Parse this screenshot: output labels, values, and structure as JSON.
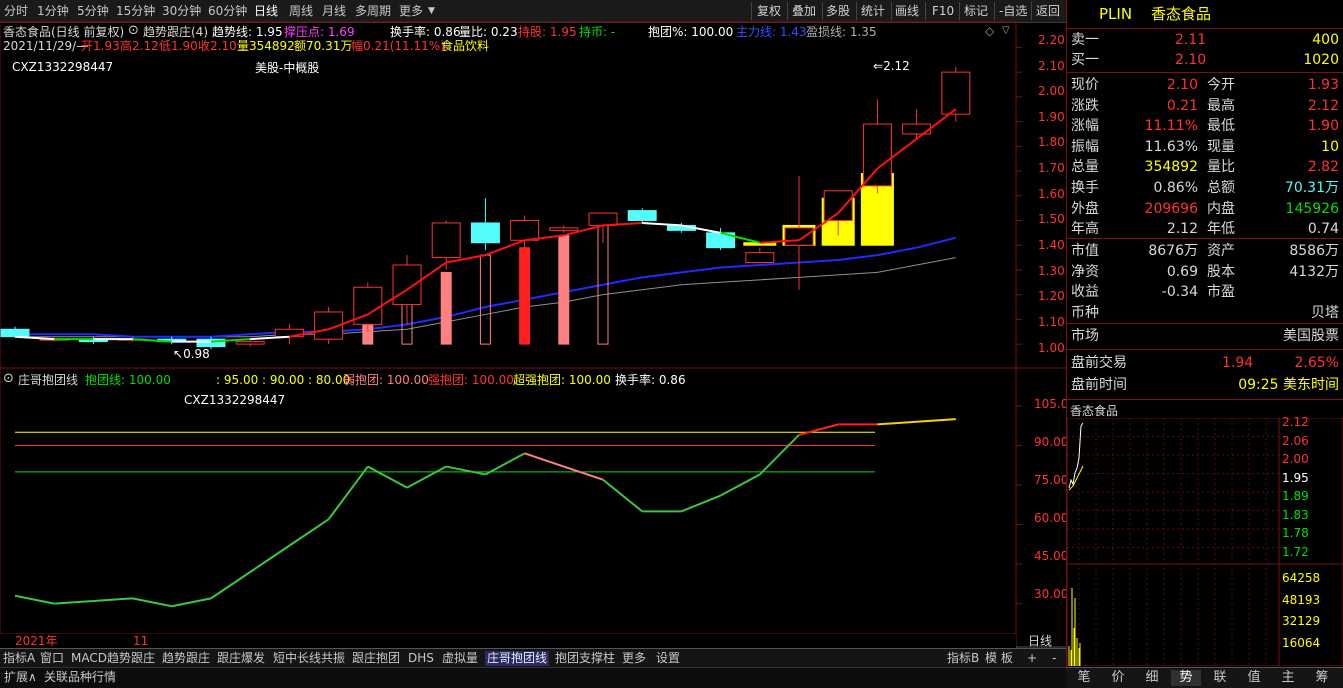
{
  "topbar": {
    "periods": [
      "分时",
      "1分钟",
      "5分钟",
      "15分钟",
      "30分钟",
      "60分钟",
      "日线",
      "周线",
      "月线",
      "多周期",
      "更多"
    ],
    "selected_period": "日线",
    "tools": [
      "复权",
      "叠加",
      "多股",
      "统计",
      "画线",
      "F10",
      "标记",
      "-自选",
      "返回"
    ]
  },
  "info": {
    "stock_title": "香态食品(日线 前复权)",
    "indicator_name": "趋势跟庄(4)",
    "trend_label": "趋势线: 1.95",
    "press_label": "撑压点: 1.69",
    "turnover_label": "换手率: 0.86",
    "volratio_label": "量比: 0.23",
    "hold_label": "持股: 1.95",
    "holdcash_label": "持币: -",
    "baotuan_label": "抱团%: 100.00",
    "main_label": "主力线: 1.43",
    "pnl_label": "盈损线: 1.35",
    "date": "2021/11/29/—",
    "open": "开1.93",
    "high": "高2.12",
    "low": "低1.90",
    "close": "收2.10",
    "vol": "量354892",
    "amount": "额70.31万",
    "change": "幅0.21(11.11%)",
    "sector": "食品饮料",
    "code_label": "CXZ1332298447",
    "market_label": "美股-中概股",
    "high_mark": "2.12",
    "low_mark": "0.98"
  },
  "price_axis": [
    "2.20",
    "2.10",
    "2.00",
    "1.90",
    "1.80",
    "1.70",
    "1.60",
    "1.50",
    "1.40",
    "1.30",
    "1.20",
    "1.10",
    "1.00"
  ],
  "lower": {
    "title": "庄哥抱团线",
    "line_label": "抱团线: 100.00",
    "levels_label": ": 95.00 : 90.00 : 80.00",
    "weak_label": "弱抱团: 100.00",
    "strong_label": "强抱团: 100.00",
    "super_label": "超强抱团: 100.00",
    "turnover_label": "换手率: 0.86",
    "code_label": "CXZ1332298447",
    "axis": [
      "105.0",
      "90.00",
      "75.00",
      "60.00",
      "45.00",
      "30.00"
    ]
  },
  "time_axis": {
    "year": "2021年",
    "month": "11",
    "period": "日线"
  },
  "bottom_tabs": [
    "指标A",
    "窗口",
    "MACD趋势跟庄",
    "趋势跟庄",
    "跟庄爆发",
    "短中长线共振",
    "跟庄抱团",
    "DHS",
    "虚拟量",
    "庄哥抱团线",
    "抱团支撑柱",
    "更多",
    "设置"
  ],
  "bottom_selected": "庄哥抱团线",
  "bottom_right": [
    "指标B",
    "模 板",
    "+",
    "-"
  ],
  "bottom2": [
    "扩展∧",
    "关联品种行情"
  ],
  "quote": {
    "symbol": "PLIN",
    "name": "香态食品",
    "ask_label": "卖一",
    "ask": "2.11",
    "ask_vol": "400",
    "bid_label": "买一",
    "bid": "2.10",
    "bid_vol": "1020",
    "rows": [
      [
        "现价",
        "2.10",
        "今开",
        "1.93"
      ],
      [
        "涨跌",
        "0.21",
        "最高",
        "2.12"
      ],
      [
        "涨幅",
        "11.11%",
        "最低",
        "1.90"
      ],
      [
        "振幅",
        "11.63%",
        "现量",
        "10"
      ],
      [
        "总量",
        "354892",
        "量比",
        "2.82"
      ],
      [
        "换手",
        "0.86%",
        "总额",
        "70.31万"
      ],
      [
        "外盘",
        "209696",
        "内盘",
        "145926"
      ],
      [
        "年高",
        "2.12",
        "年低",
        "0.74"
      ]
    ],
    "rows2": [
      [
        "市值",
        "8676万",
        "资产",
        "8586万"
      ],
      [
        "净资",
        "0.69",
        "股本",
        "4132万"
      ],
      [
        "收益",
        "-0.34",
        "市盈",
        ""
      ],
      [
        "币种",
        "",
        "",
        "贝塔"
      ]
    ],
    "market_label": "市场",
    "market_value": "美国股票",
    "pre_label": "盘前交易",
    "pre_price": "1.94",
    "pre_pct": "2.65%",
    "pretime_label": "盘前时间",
    "pretime_value": "09:25 美东时间"
  },
  "mini": {
    "title": "香态食品",
    "price_axis": [
      "2.12",
      "2.06",
      "2.00",
      "1.95",
      "1.89",
      "1.83",
      "1.78",
      "1.72"
    ],
    "vol_axis": [
      "64258",
      "48193",
      "32129",
      "16064"
    ]
  },
  "right_tabs": [
    "笔",
    "价",
    "细",
    "势",
    "联",
    "值",
    "主",
    "筹"
  ],
  "right_selected": "势",
  "colors": {
    "up": "#ff3232",
    "down": "#54fcfc",
    "white": "#ffffff",
    "yellow": "#ffff00",
    "blue": "#1010ff",
    "green": "#00e000",
    "frame": "#7a1010"
  },
  "chart_data": {
    "type": "candlestick",
    "candles": [
      {
        "o": 1.06,
        "h": 1.07,
        "l": 1.03,
        "c": 1.03
      },
      {
        "o": 1.02,
        "h": 1.03,
        "l": 1.01,
        "c": 1.02
      },
      {
        "o": 1.02,
        "h": 1.03,
        "l": 1.0,
        "c": 1.01
      },
      {
        "o": 1.02,
        "h": 1.03,
        "l": 1.01,
        "c": 1.02
      },
      {
        "o": 1.02,
        "h": 1.03,
        "l": 1.0,
        "c": 1.01
      },
      {
        "o": 1.02,
        "h": 1.03,
        "l": 0.98,
        "c": 0.99
      },
      {
        "o": 1.0,
        "h": 1.02,
        "l": 0.99,
        "c": 1.01
      },
      {
        "o": 1.03,
        "h": 1.08,
        "l": 1.0,
        "c": 1.06
      },
      {
        "o": 1.02,
        "h": 1.15,
        "l": 1.0,
        "c": 1.13
      },
      {
        "o": 1.08,
        "h": 1.25,
        "l": 1.05,
        "c": 1.23
      },
      {
        "o": 1.16,
        "h": 1.36,
        "l": 1.08,
        "c": 1.32
      },
      {
        "o": 1.35,
        "h": 1.5,
        "l": 1.3,
        "c": 1.49
      },
      {
        "o": 1.49,
        "h": 1.59,
        "l": 1.38,
        "c": 1.41
      },
      {
        "o": 1.42,
        "h": 1.52,
        "l": 1.38,
        "c": 1.5
      },
      {
        "o": 1.46,
        "h": 1.48,
        "l": 1.45,
        "c": 1.47
      },
      {
        "o": 1.48,
        "h": 1.53,
        "l": 1.41,
        "c": 1.53
      },
      {
        "o": 1.54,
        "h": 1.55,
        "l": 1.49,
        "c": 1.5
      },
      {
        "o": 1.48,
        "h": 1.49,
        "l": 1.45,
        "c": 1.46
      },
      {
        "o": 1.45,
        "h": 1.47,
        "l": 1.38,
        "c": 1.39
      },
      {
        "o": 1.33,
        "h": 1.39,
        "l": 1.33,
        "c": 1.37
      },
      {
        "o": 1.4,
        "h": 1.68,
        "l": 1.22,
        "c": 1.47
      },
      {
        "o": 1.5,
        "h": 1.62,
        "l": 1.44,
        "c": 1.62
      },
      {
        "o": 1.64,
        "h": 1.99,
        "l": 1.61,
        "c": 1.89
      },
      {
        "o": 1.85,
        "h": 1.95,
        "l": 1.83,
        "c": 1.89
      },
      {
        "o": 1.93,
        "h": 2.12,
        "l": 1.9,
        "c": 2.1
      }
    ],
    "trend_line": [
      1.03,
      1.02,
      1.02,
      1.02,
      1.01,
      1.01,
      1.02,
      1.03,
      1.06,
      1.12,
      1.22,
      1.33,
      1.36,
      1.42,
      1.44,
      1.48,
      1.49,
      1.48,
      1.45,
      1.41,
      1.42,
      1.53,
      1.71,
      1.83,
      1.95
    ],
    "main_line": [
      1.04,
      1.04,
      1.04,
      1.03,
      1.03,
      1.03,
      1.04,
      1.05,
      1.05,
      1.06,
      1.08,
      1.11,
      1.15,
      1.18,
      1.21,
      1.24,
      1.27,
      1.29,
      1.31,
      1.32,
      1.33,
      1.34,
      1.36,
      1.39,
      1.43
    ],
    "pnl_line": [
      1.03,
      1.03,
      1.03,
      1.03,
      1.03,
      1.03,
      1.03,
      1.04,
      1.04,
      1.05,
      1.06,
      1.09,
      1.12,
      1.15,
      1.17,
      1.2,
      1.22,
      1.24,
      1.25,
      1.26,
      1.27,
      1.28,
      1.29,
      1.32,
      1.35
    ],
    "pillars": [
      {
        "i": 9,
        "v": 1.13,
        "style": "pink"
      },
      {
        "i": 10,
        "v": 1.23,
        "style": "hollow"
      },
      {
        "i": 11,
        "v": 1.29,
        "style": "pink"
      },
      {
        "i": 12,
        "v": 1.36,
        "style": "hollow"
      },
      {
        "i": 13,
        "v": 1.39,
        "style": "red"
      },
      {
        "i": 14,
        "v": 1.44,
        "style": "pink"
      },
      {
        "i": 15,
        "v": 1.48,
        "style": "hollow"
      },
      {
        "i": 19,
        "v": 1.41,
        "style": "yellow"
      },
      {
        "i": 20,
        "v": 1.48,
        "style": "yellow"
      },
      {
        "i": 21,
        "v": 1.59,
        "style": "yellow"
      },
      {
        "i": 22,
        "v": 1.69,
        "style": "yellow"
      }
    ],
    "baotuan_line": [
      33,
      30,
      31,
      32,
      29,
      32,
      42,
      52,
      62,
      82,
      74,
      82,
      79,
      87,
      82,
      77,
      65,
      65,
      71,
      79,
      94,
      98,
      98,
      99,
      100
    ],
    "levels": [
      95,
      90,
      80
    ],
    "price_range": [
      0.96,
      2.23
    ],
    "osc_range": [
      20,
      108
    ]
  }
}
